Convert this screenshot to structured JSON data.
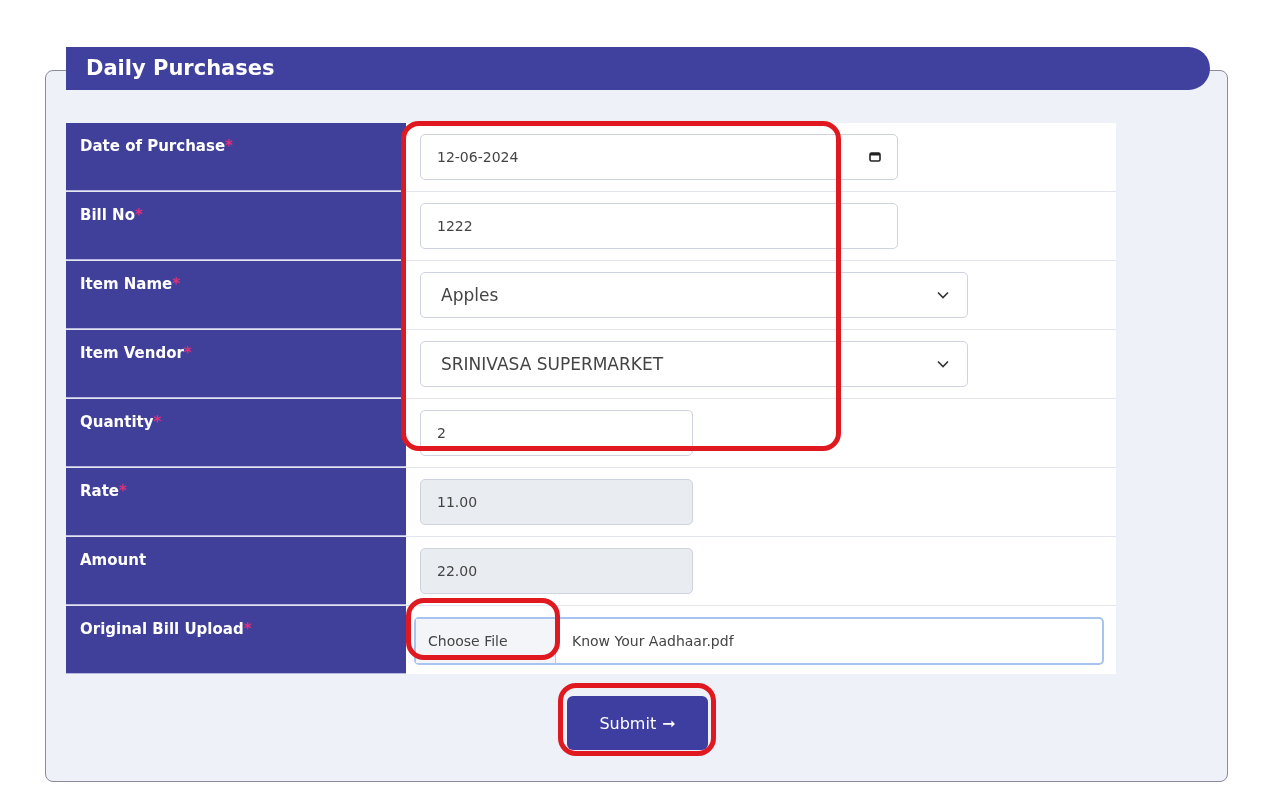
{
  "panel": {
    "title": "Daily Purchases"
  },
  "rows": [
    {
      "label": "Date of Purchase",
      "required_mark": "*",
      "kind": "date",
      "value": "12-06-2024"
    },
    {
      "label": "Bill No",
      "required_mark": "*",
      "kind": "text",
      "value": "1222"
    },
    {
      "label": "Item Name",
      "required_mark": "*",
      "kind": "select",
      "value": "Apples"
    },
    {
      "label": "Item Vendor",
      "required_mark": "*",
      "kind": "select",
      "value": "SRINIVASA SUPERMARKET"
    },
    {
      "label": "Quantity",
      "required_mark": "*",
      "kind": "short",
      "value": "2"
    },
    {
      "label": "Rate",
      "required_mark": "*",
      "kind": "readonly",
      "value": "11.00"
    },
    {
      "label": "Amount",
      "kind": "readonly",
      "value": "22.00"
    },
    {
      "label": "Original Bill Upload",
      "required_mark": "*",
      "kind": "file",
      "button": "Choose File",
      "value": "Know Your Aadhaar.pdf"
    }
  ],
  "submit": {
    "label": "Submit",
    "arrow": "➞"
  },
  "annotations": [
    {
      "kind": "fields"
    },
    {
      "kind": "file-button"
    },
    {
      "kind": "submit"
    }
  ]
}
